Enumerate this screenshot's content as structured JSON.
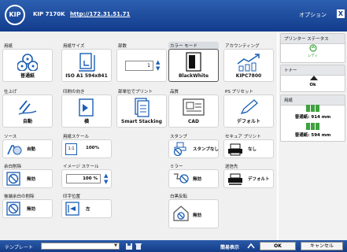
{
  "title_bar": {
    "logo": "KIP",
    "printer_name": "KIP 7170K",
    "url": "http://172.31.51.71",
    "options_label": "オプション",
    "close_label": "X"
  },
  "tiles": {
    "paper": {
      "label": "用紙",
      "value": "普通紙",
      "icon": "plain-paper-icon"
    },
    "paper_size": {
      "label": "用紙サイズ",
      "value": "ISO A1 594x841",
      "icon": "paper-size-icon"
    },
    "copies": {
      "label": "部数",
      "value": "1"
    },
    "color_mode": {
      "label": "カラー モード",
      "value": "BlackWhite",
      "icon": "black-white-icon"
    },
    "accounting": {
      "label": "アカウンティング",
      "value": "KIPC7800",
      "icon": "accounting-chart-icon"
    },
    "finishing": {
      "label": "仕上げ",
      "value": "自動",
      "icon": "finishing-icon"
    },
    "orientation": {
      "label": "印刷の向き",
      "value": "横",
      "icon": "orientation-icon"
    },
    "collate": {
      "label": "部単位でプリント",
      "value": "Smart Stacking",
      "icon": "stacking-icon"
    },
    "quality": {
      "label": "品質",
      "value": "CAD",
      "icon": "cad-icon"
    },
    "ps_preset": {
      "label": "PS プリセット",
      "value": "デフォルト",
      "icon": "pen-icon"
    },
    "source": {
      "label": "ソース",
      "value": "自動",
      "icon": "source-icon"
    },
    "paper_scale": {
      "label": "用紙スケール",
      "value": "100%",
      "icon": "scale-icon",
      "icon_text": "1:1"
    },
    "stamp": {
      "label": "スタンプ",
      "value": "スタンプなし",
      "icon": "no-stamp-icon"
    },
    "secure_print": {
      "label": "セキュア プリント",
      "value": "なし",
      "icon": "secure-print-icon"
    },
    "margin_delete": {
      "label": "余白削除",
      "value": "無効",
      "icon": "disabled-icon"
    },
    "image_scale": {
      "label": "イメージ スケール",
      "value": "100 %"
    },
    "mirror": {
      "label": "ミラー",
      "value": "無効",
      "icon": "mirror-icon"
    },
    "output": {
      "label": "送信先",
      "value": "デフォルト",
      "icon": "output-tray-icon"
    },
    "trailing_margin": {
      "label": "後端余白の削除",
      "value": "無効",
      "icon": "disabled-icon"
    },
    "print_position": {
      "label": "印字位置",
      "value": "左",
      "icon": "align-left-icon"
    },
    "white_black_invert": {
      "label": "白黒反転",
      "value": "無効",
      "icon": "invert-icon"
    }
  },
  "sidebar": {
    "status_header": "プリンター ステータス",
    "status_value": "レディ",
    "toner_header": "トナー",
    "toner_value": "Ok",
    "paper_header": "用紙",
    "rolls": [
      {
        "label": "普通紙: 914 mm"
      },
      {
        "label": "普通紙: 594 mm"
      }
    ]
  },
  "footer": {
    "template_label": "テンプレート",
    "simple_view": "簡易表示",
    "ok": "OK",
    "cancel": "キャンセル"
  },
  "colors": {
    "title_bar": "#1f4fa3",
    "green": "#3ea23e",
    "blue": "#1b5fb5"
  }
}
